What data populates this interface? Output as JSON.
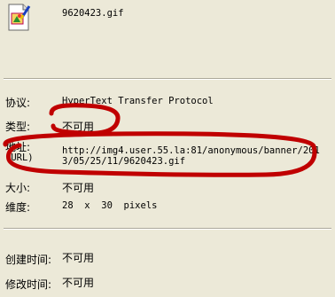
{
  "file": {
    "name": "9620423.gif",
    "icon": "gif-image-file-icon"
  },
  "properties": {
    "protocol": {
      "label": "协议:",
      "value": "HyperText Transfer Protocol"
    },
    "type": {
      "label": "类型:",
      "value": "不可用"
    },
    "address": {
      "label_line1": "地址:",
      "label_line2": "(URL)",
      "value": "http://img4.user.55.la:81/anonymous/banner/2013/05/25/11/9620423.gif"
    },
    "size": {
      "label": "大小:",
      "value": "不可用"
    },
    "dimensions": {
      "label": "维度:",
      "value": "28  x  30  pixels"
    },
    "created": {
      "label": "创建时间:",
      "value": "不可用"
    },
    "modified": {
      "label": "修改时间:",
      "value": "不可用"
    }
  },
  "annotation_color": "#c00000"
}
